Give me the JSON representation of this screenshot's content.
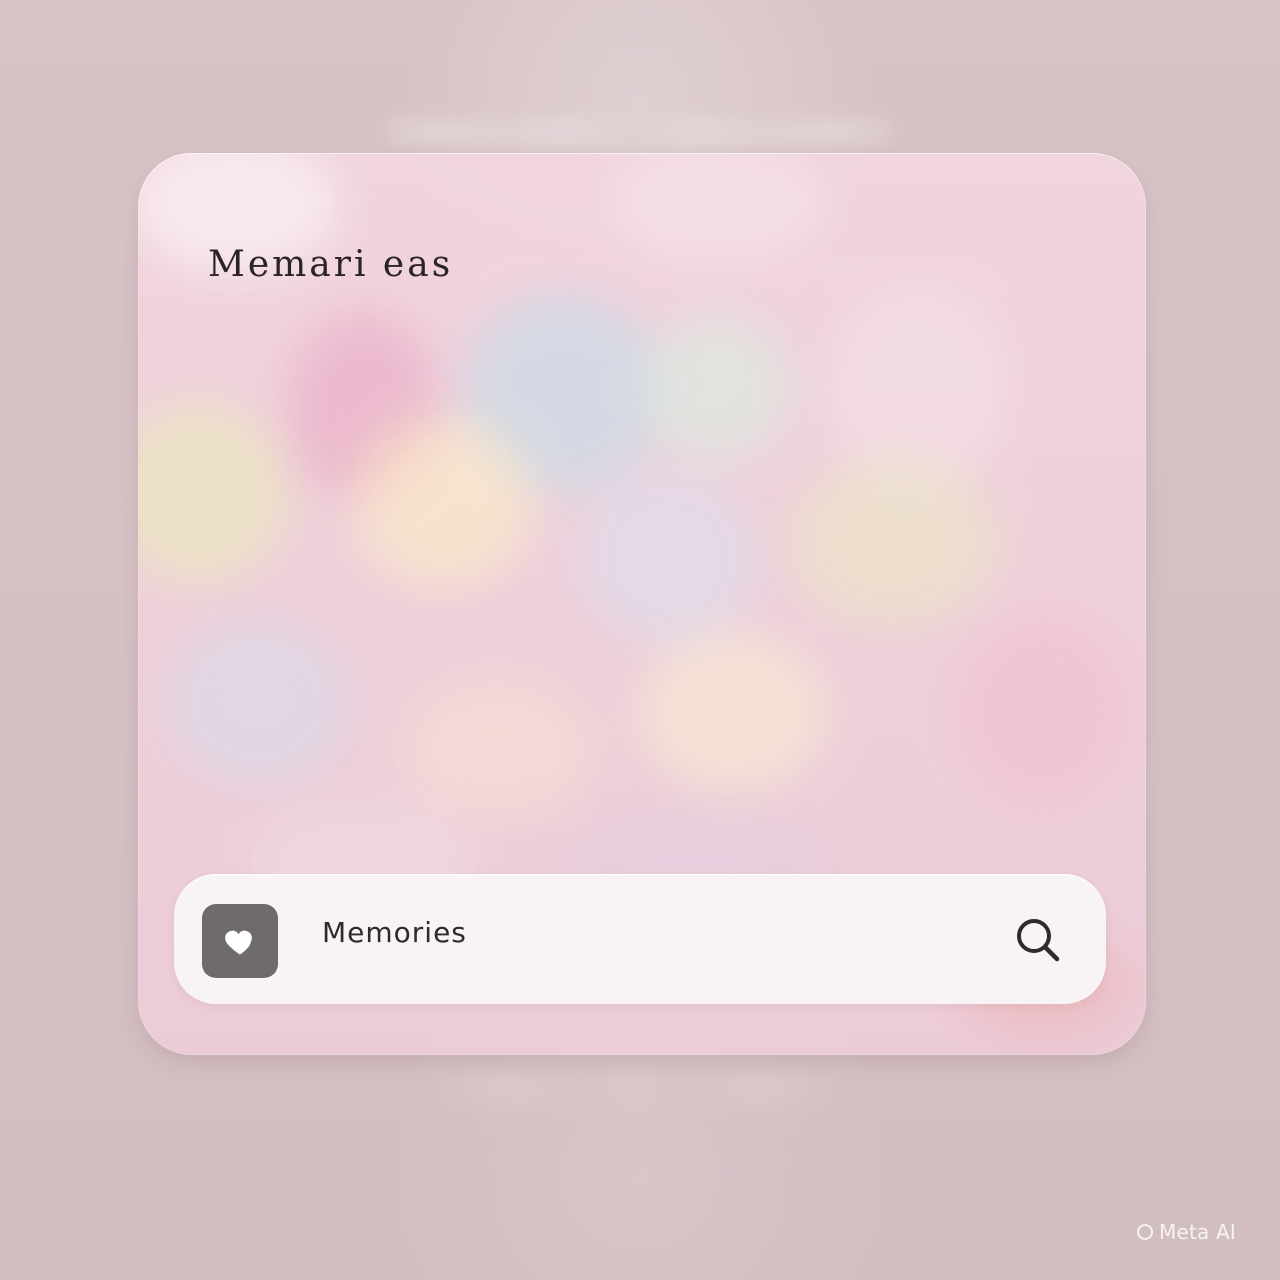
{
  "widget": {
    "title": "Memari eas",
    "search_label": "Memories"
  },
  "icons": {
    "heart": "heart-icon",
    "search": "search-icon",
    "watermark": "meta-ai-icon"
  },
  "colors": {
    "background": "#d6c2c4",
    "card_tint": "#f0d1dd",
    "search_bar": "#f7f4f5",
    "heart_tile": "#6f6b6d",
    "text_dark": "#2f2b2c"
  },
  "watermark": {
    "text": "Meta AI"
  }
}
